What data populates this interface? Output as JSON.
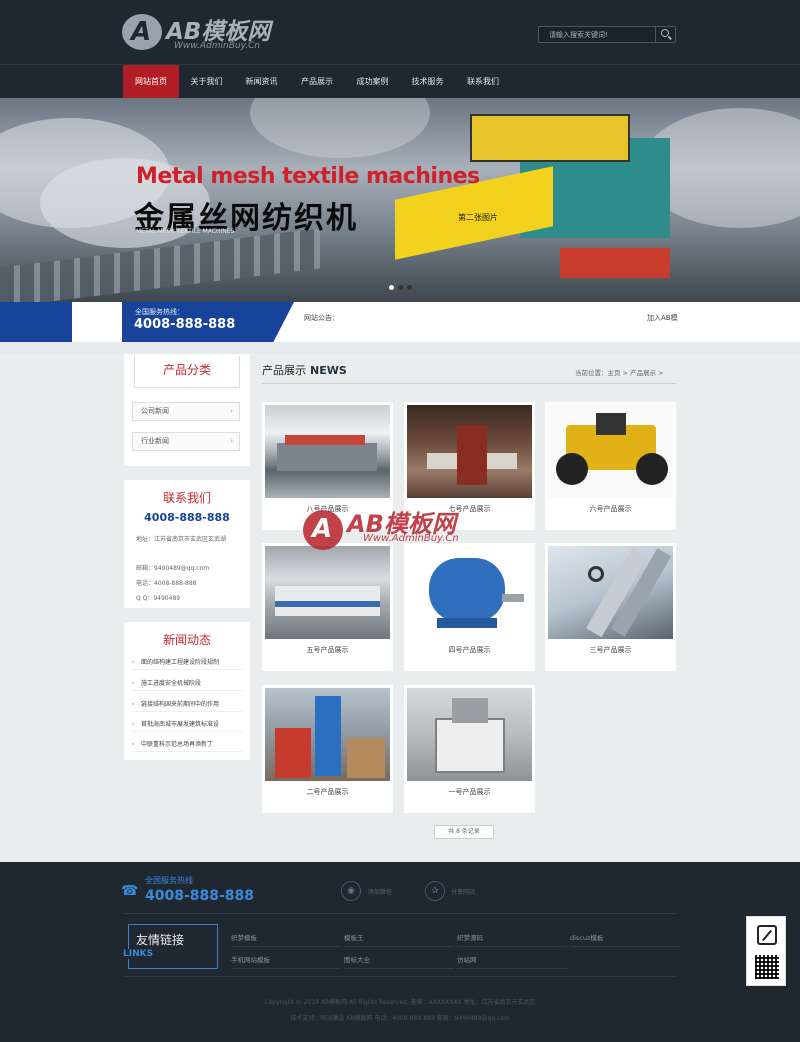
{
  "header": {
    "logo_text": "AB模板网",
    "logo_badge": "A",
    "logo_sub": "Www.AdminBuy.Cn",
    "search_placeholder": "请输入搜索关键词!"
  },
  "nav": [
    {
      "label": "网站首页",
      "active": true
    },
    {
      "label": "关于我们"
    },
    {
      "label": "新闻资讯"
    },
    {
      "label": "产品展示"
    },
    {
      "label": "成功案例"
    },
    {
      "label": "技术服务"
    },
    {
      "label": "联系我们"
    }
  ],
  "banner": {
    "title_en": "Metal mesh textile machines",
    "title_cn": "金属丝网纺织机",
    "small_en": "METAL MESH TEXTILE MACHINES",
    "image_label": "第二张图片",
    "slides_total": 3,
    "active_slide": 2
  },
  "notice": {
    "hotline_label": "全国服务热线：",
    "hotline": "4008-888-888",
    "label": "网站公告：",
    "text": "加入AB模"
  },
  "sidebar": {
    "category_title": "产品分类",
    "categories": [
      "公司新闻",
      "行业新闻"
    ],
    "contact_title": "联系我们",
    "contact_phone": "4008-888-888",
    "contact_lines": [
      "地址：江苏省南京市玄武区玄武湖",
      "邮箱：9490489@qq.com",
      "电话：4008-888-888",
      "Q Q：9490489"
    ],
    "news_title": "新闻动态",
    "news": [
      "面的结构建工程建设阶段规制",
      "施工进度安全机械阶段",
      "链接结构国来前期间中的作用",
      "首批海南城市展发建筑标准设",
      "中联重科示范总场再添新丁"
    ]
  },
  "main": {
    "title": "产品展示",
    "title_en": "NEWS",
    "breadcrumb": "当前位置：主页 > 产品展示 >",
    "products": [
      {
        "caption": "八号产品展示",
        "icon": "factory-photo"
      },
      {
        "caption": "七号产品展示",
        "icon": "factory-photo"
      },
      {
        "caption": "六号产品展示",
        "icon": "tractor-photo"
      },
      {
        "caption": "五号产品展示",
        "icon": "factory-photo"
      },
      {
        "caption": "四号产品展示",
        "icon": "motor-photo"
      },
      {
        "caption": "三号产品展示",
        "icon": "pipes-photo"
      },
      {
        "caption": "二号产品展示",
        "icon": "plant-photo"
      },
      {
        "caption": "一号产品展示",
        "icon": "plant-photo"
      }
    ],
    "pager": "共 8 条记录"
  },
  "watermark": {
    "text": "AB模板网",
    "badge": "A",
    "sub": "Www.AdminBuy.Cn"
  },
  "footer": {
    "phone_label": "全国服务热线",
    "phone": "4008-888-888",
    "social": [
      "添加微信",
      "分享网站"
    ],
    "links_title": "友情链接",
    "links_en": "LINKS",
    "links": [
      "织梦模板",
      "模板王",
      "织梦源码",
      "discuz模板",
      "手机网站模板",
      "图标大全",
      "仿站网"
    ],
    "copyright_lines": [
      "Copyright © 2019 AB模板网 All Rights Reserved.   备案：XXXXXXXX   地址：江苏省南京市玄武区",
      "技术支持：网站建设 AB模板网   电话：4008-888-888   邮箱：9490489@qq.com"
    ]
  },
  "colors": {
    "header_bg": "#1f2730",
    "accent_red": "#b11d24",
    "accent_blue": "#17439a",
    "footer_blue": "#3b8ad9"
  }
}
